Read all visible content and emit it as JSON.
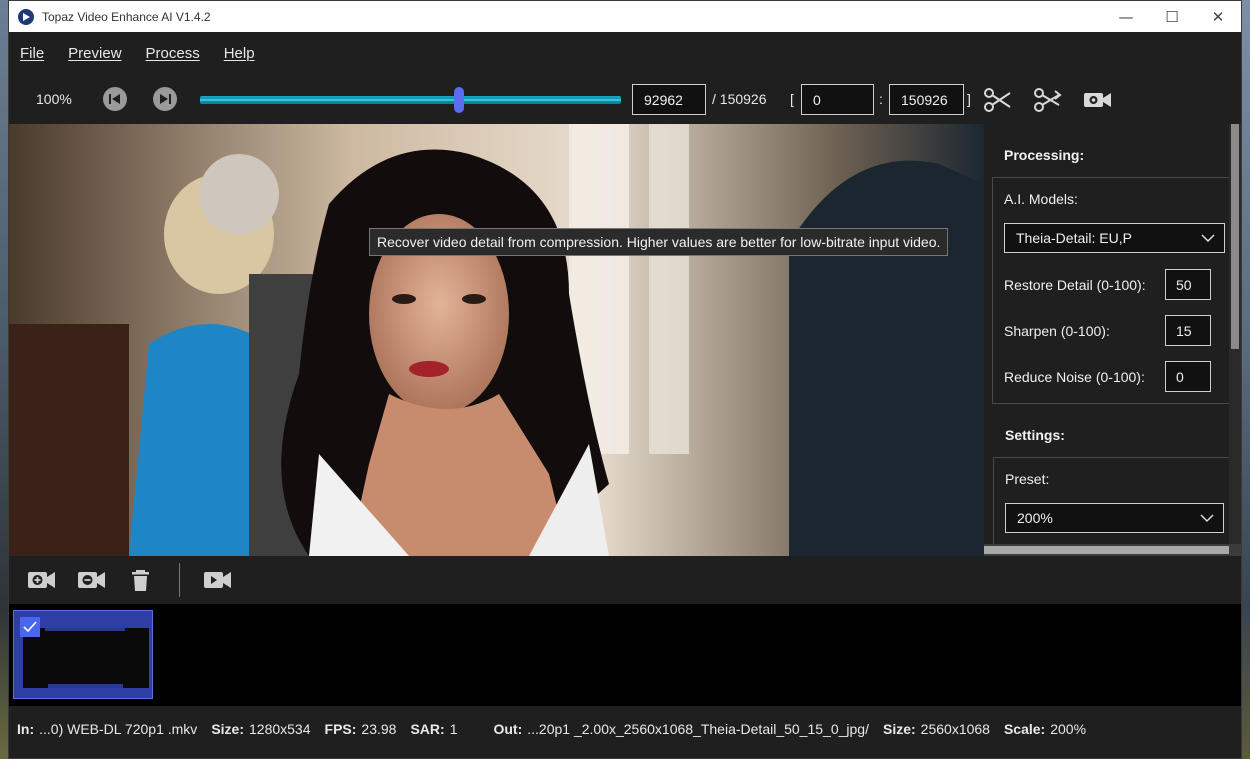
{
  "window": {
    "title": "Topaz Video Enhance AI V1.4.2",
    "minimize": "—",
    "maximize": "☐",
    "close": "✕"
  },
  "menu": {
    "file": "File",
    "preview": "Preview",
    "process": "Process",
    "help": "Help"
  },
  "toolbar": {
    "zoom": "100%",
    "current_frame": "92962",
    "total_frames": "/ 150926",
    "range_open": "[",
    "range_start": "0",
    "range_sep": ":",
    "range_end": "150926",
    "range_close": "]",
    "slider_position": 0.616
  },
  "tooltip": {
    "text": "Recover video detail from compression. Higher values are better for low-bitrate input video."
  },
  "panel": {
    "processing_title": "Processing:",
    "ai_models_label": "A.I. Models:",
    "ai_model_value": "Theia-Detail: EU,P",
    "restore_label": "Restore Detail (0-100):",
    "restore_value": "50",
    "sharpen_label": "Sharpen (0-100):",
    "sharpen_value": "15",
    "noise_label": "Reduce Noise (0-100):",
    "noise_value": "0",
    "settings_title": "Settings:",
    "preset_label": "Preset:",
    "preset_value": "200%"
  },
  "status": {
    "in_label": "In:",
    "in_value": "...0) WEB-DL  720p1 .mkv",
    "size_label": "Size:",
    "size_value": "1280x534",
    "fps_label": "FPS:",
    "fps_value": "23.98",
    "sar_label": "SAR:",
    "sar_value": "1",
    "out_label": "Out:",
    "out_value": "...20p1 _2.00x_2560x1068_Theia-Detail_50_15_0_jpg/",
    "out_size_label": "Size:",
    "out_size_value": "2560x1068",
    "scale_label": "Scale:",
    "scale_value": "200%"
  },
  "colors": {
    "accent": "#4a66ef",
    "slider": "#1aa6c4",
    "window_bg": "#1f1f1f"
  }
}
